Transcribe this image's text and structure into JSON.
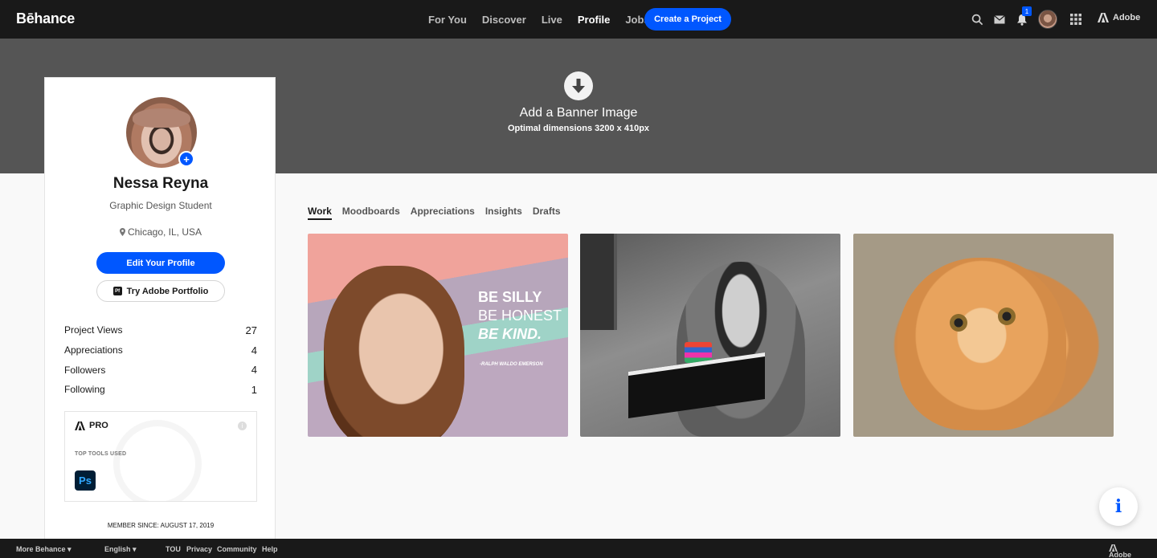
{
  "topnav": {
    "logo": "Bēhance",
    "links": [
      "For You",
      "Discover",
      "Live",
      "Profile",
      "Jobs"
    ],
    "active_link": "Profile",
    "create_label": "Create a Project",
    "notification_count": "1",
    "adobe_label": "Adobe",
    "icons": [
      "search-icon",
      "mail-icon",
      "bell-icon",
      "apps-grid-icon",
      "adobe-logo-icon"
    ]
  },
  "banner": {
    "title": "Add a Banner Image",
    "subtitle": "Optimal dimensions 3200 x 410px"
  },
  "profile": {
    "name": "Nessa Reyna",
    "role": "Graphic Design Student",
    "location": "Chicago, IL, USA",
    "edit_label": "Edit Your Profile",
    "portfolio_label": "Try Adobe Portfolio",
    "portfolio_icon_text": "Pf",
    "stats": [
      {
        "label": "Project Views",
        "value": "27"
      },
      {
        "label": "Appreciations",
        "value": "4"
      },
      {
        "label": "Followers",
        "value": "4"
      },
      {
        "label": "Following",
        "value": "1"
      }
    ],
    "pro_label": "PRO",
    "tools_label": "TOP TOOLS USED",
    "tool_icon_text": "Ps",
    "member_since": "MEMBER SINCE: AUGUST 17, 2019"
  },
  "tabs": [
    "Work",
    "Moodboards",
    "Appreciations",
    "Insights",
    "Drafts"
  ],
  "active_tab": "Work",
  "projects": {
    "p1": {
      "line1": "BE SILLY",
      "line2": "BE HONEST",
      "line3": "BE KIND.",
      "author": "-RALPH WALDO EMERSON"
    }
  },
  "footer": {
    "more": "More Behance ▾",
    "language": "English ▾",
    "links": [
      "TOU",
      "Privacy",
      "Community",
      "Help"
    ],
    "adobe_label": "Adobe"
  },
  "colors": {
    "accent": "#0057ff",
    "nav_bg": "#191919",
    "banner_bg": "#555555"
  }
}
